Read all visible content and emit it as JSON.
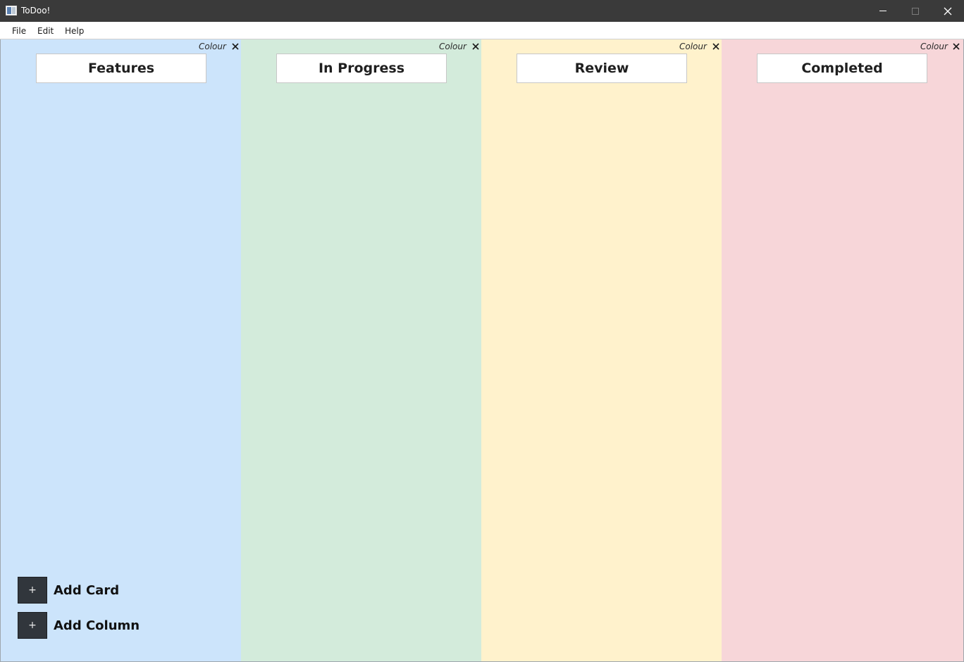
{
  "window": {
    "title": "ToDoo!",
    "controls": {
      "minimize": "minimize-icon",
      "maximize": "maximize-icon",
      "close": "close-icon"
    }
  },
  "menu": {
    "items": [
      {
        "label": "File"
      },
      {
        "label": "Edit"
      },
      {
        "label": "Help"
      }
    ]
  },
  "columns": [
    {
      "title": "Features",
      "colour_label": "Colour",
      "close_label": "X",
      "background": "#cce4fb"
    },
    {
      "title": "In Progress",
      "colour_label": "Colour",
      "close_label": "X",
      "background": "#d3ebdb"
    },
    {
      "title": "Review",
      "colour_label": "Colour",
      "close_label": "X",
      "background": "#fff2cc"
    },
    {
      "title": "Completed",
      "colour_label": "Colour",
      "close_label": "X",
      "background": "#f7d6d9"
    }
  ],
  "actions": {
    "add_card": {
      "icon": "+",
      "label": "Add Card"
    },
    "add_column": {
      "icon": "+",
      "label": "Add Column"
    }
  },
  "colors": {
    "titlebar": "#3a3a3a",
    "action_button": "#31363c"
  }
}
